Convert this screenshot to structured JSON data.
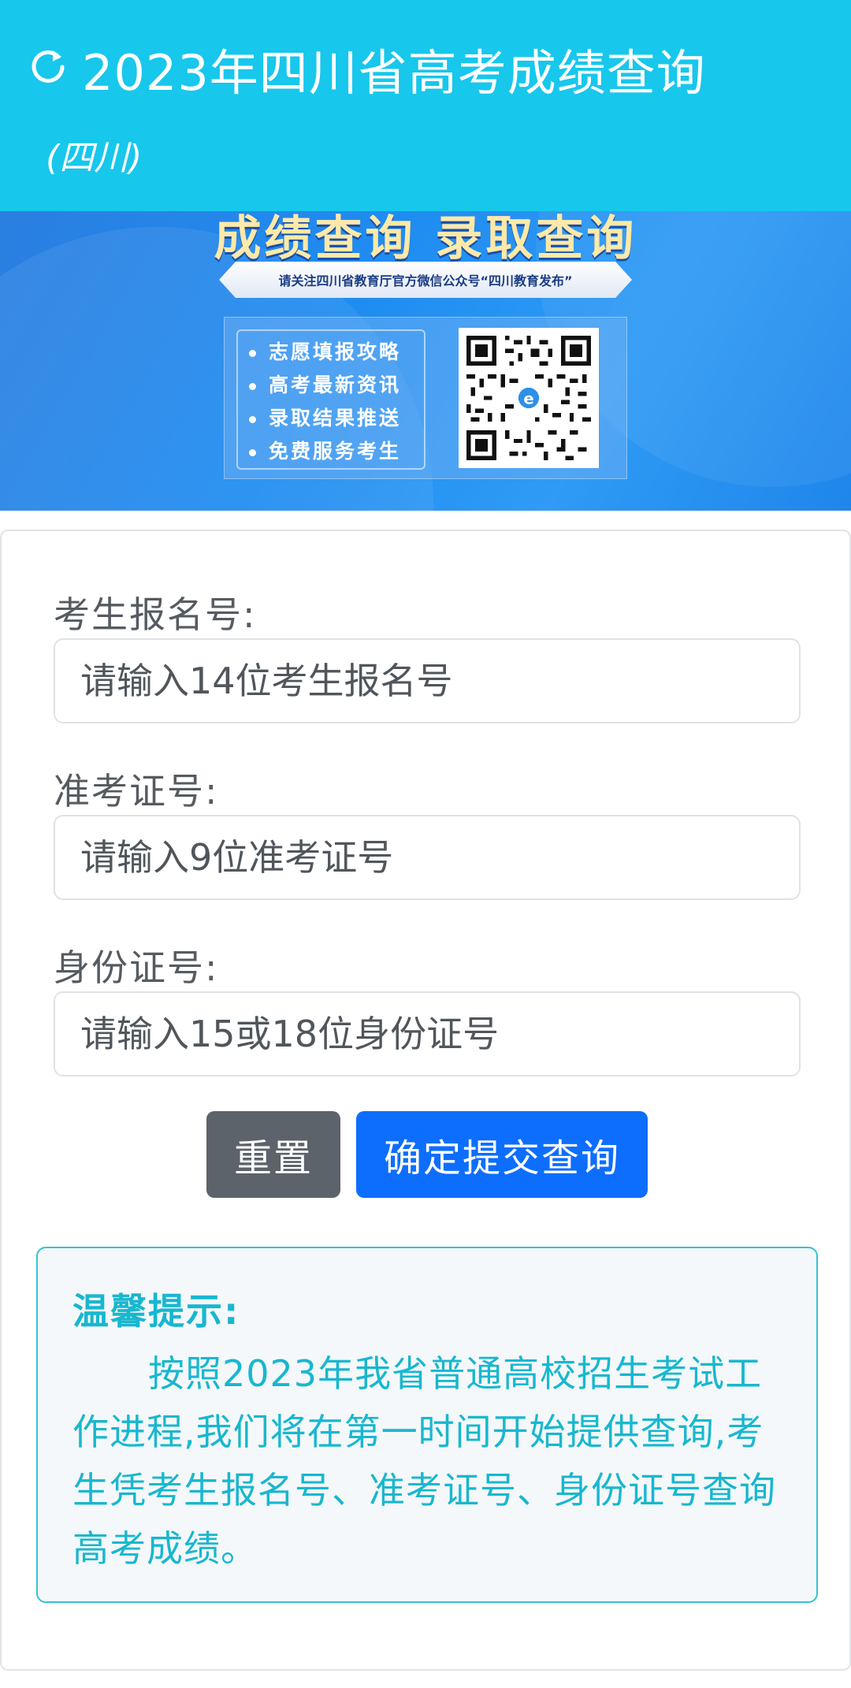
{
  "header": {
    "title": "2023年四川省高考成绩查询",
    "region": "(四川)",
    "refresh_icon": "refresh-icon"
  },
  "banner": {
    "headline": "成绩查询 录取查询",
    "ribbon": "请关注四川省教育厅官方微信公众号“四川教育发布”",
    "features": [
      "志愿填报攻略",
      "高考最新资讯",
      "录取结果推送",
      "免费服务考生"
    ],
    "qr_icon": "qr-code-icon"
  },
  "form": {
    "reg_label": "考生报名号:",
    "reg_placeholder": "请输入14位考生报名号",
    "exam_label": "准考证号:",
    "exam_placeholder": "请输入9位准考证号",
    "id_label": "身份证号:",
    "id_placeholder": "请输入15或18位身份证号",
    "reset_label": "重置",
    "submit_label": "确定提交查询"
  },
  "tip": {
    "title": "温馨提示:",
    "body": "按照2023年我省普通高校招生考试工作进程,我们将在第一时间开始提供查询,考生凭考生报名号、准考证号、身份证号查询高考成绩。"
  },
  "colors": {
    "header_bg": "#17c7ec",
    "submit_bg": "#0d6efd",
    "reset_bg": "#5c636a",
    "tip_text": "#18b7cf"
  }
}
